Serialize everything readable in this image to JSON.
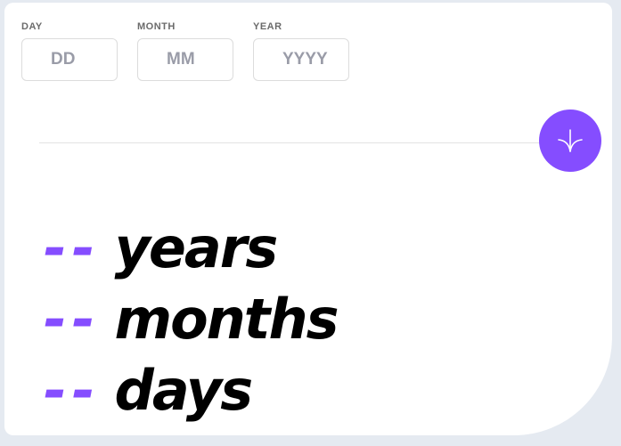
{
  "form": {
    "day": {
      "label": "DAY",
      "placeholder": "DD",
      "value": ""
    },
    "month": {
      "label": "MONTH",
      "placeholder": "MM",
      "value": ""
    },
    "year": {
      "label": "YEAR",
      "placeholder": "YYYY",
      "value": ""
    }
  },
  "submit": {
    "icon": "arrow-down-icon"
  },
  "results": [
    {
      "value": "--",
      "unit": "years"
    },
    {
      "value": "--",
      "unit": "months"
    },
    {
      "value": "--",
      "unit": "days"
    }
  ],
  "colors": {
    "accent": "#854dff",
    "background": "#e5eaf1",
    "card": "#ffffff",
    "label": "#6b6b6b",
    "placeholder": "#9a9ca8",
    "text": "#000000"
  }
}
